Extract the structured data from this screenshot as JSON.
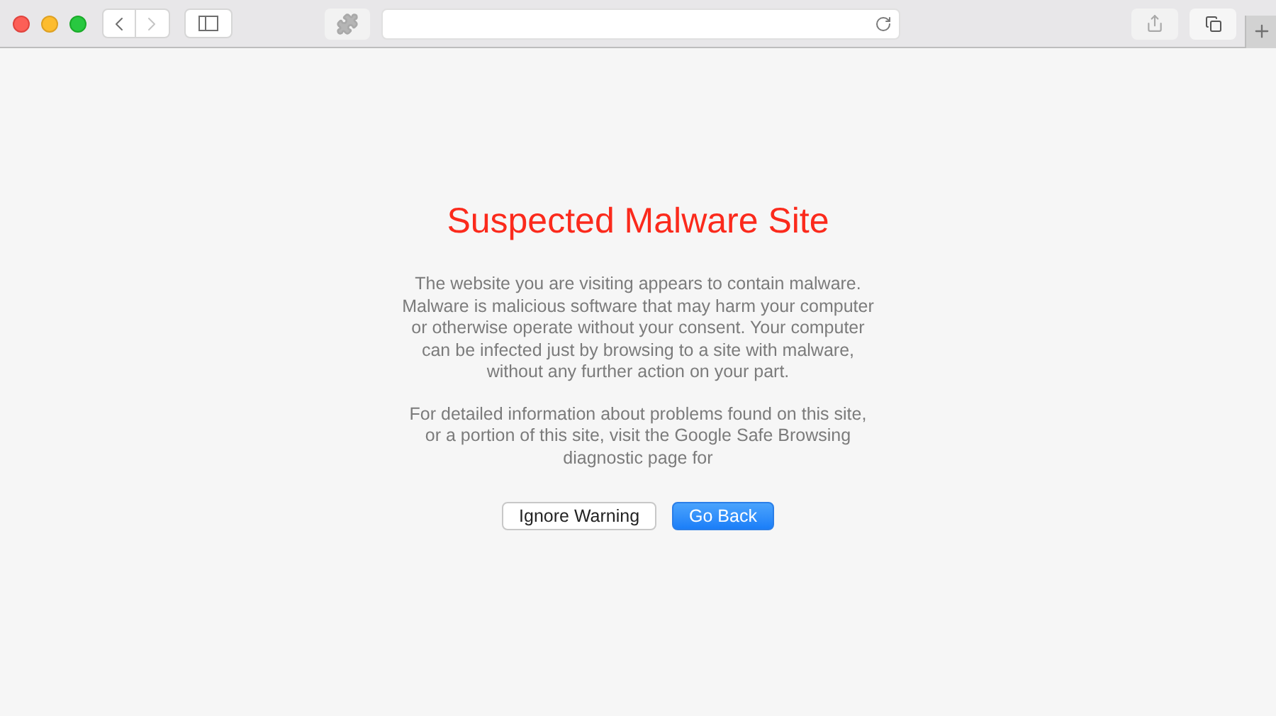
{
  "toolbar": {
    "back": {
      "disabled": false
    },
    "forward": {
      "disabled": true
    }
  },
  "warning": {
    "title": "Suspected Malware Site",
    "paragraphs": [
      [
        "The website you are visiting appears to contain malware.",
        "Malware is malicious software that may harm your computer",
        "or otherwise operate without your consent. Your computer",
        "can be infected just by browsing to a site with malware,",
        "without any further action on your part."
      ],
      [
        "For detailed information about problems found on this site,",
        "or a portion of this site, visit the Google Safe Browsing",
        "diagnostic page for"
      ]
    ],
    "buttons": [
      {
        "label": "Ignore Warning",
        "primary": false
      },
      {
        "label": "Go Back",
        "primary": true
      }
    ]
  }
}
